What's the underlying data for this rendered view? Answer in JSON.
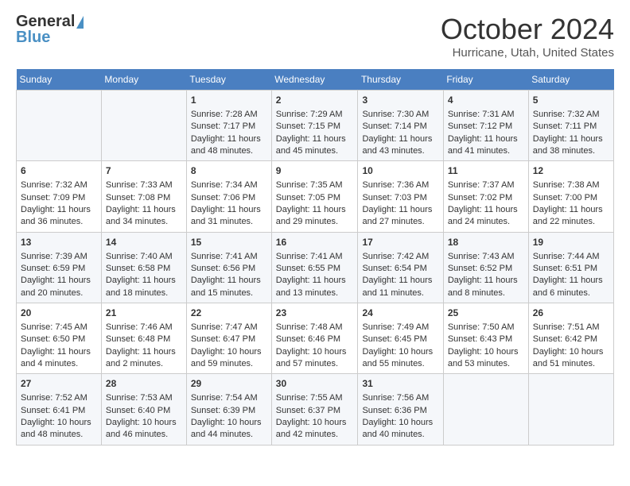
{
  "logo": {
    "general": "General",
    "blue": "Blue"
  },
  "title": "October 2024",
  "location": "Hurricane, Utah, United States",
  "days_of_week": [
    "Sunday",
    "Monday",
    "Tuesday",
    "Wednesday",
    "Thursday",
    "Friday",
    "Saturday"
  ],
  "weeks": [
    [
      {
        "day": "",
        "sunrise": "",
        "sunset": "",
        "daylight": ""
      },
      {
        "day": "",
        "sunrise": "",
        "sunset": "",
        "daylight": ""
      },
      {
        "day": "1",
        "sunrise": "Sunrise: 7:28 AM",
        "sunset": "Sunset: 7:17 PM",
        "daylight": "Daylight: 11 hours and 48 minutes."
      },
      {
        "day": "2",
        "sunrise": "Sunrise: 7:29 AM",
        "sunset": "Sunset: 7:15 PM",
        "daylight": "Daylight: 11 hours and 45 minutes."
      },
      {
        "day": "3",
        "sunrise": "Sunrise: 7:30 AM",
        "sunset": "Sunset: 7:14 PM",
        "daylight": "Daylight: 11 hours and 43 minutes."
      },
      {
        "day": "4",
        "sunrise": "Sunrise: 7:31 AM",
        "sunset": "Sunset: 7:12 PM",
        "daylight": "Daylight: 11 hours and 41 minutes."
      },
      {
        "day": "5",
        "sunrise": "Sunrise: 7:32 AM",
        "sunset": "Sunset: 7:11 PM",
        "daylight": "Daylight: 11 hours and 38 minutes."
      }
    ],
    [
      {
        "day": "6",
        "sunrise": "Sunrise: 7:32 AM",
        "sunset": "Sunset: 7:09 PM",
        "daylight": "Daylight: 11 hours and 36 minutes."
      },
      {
        "day": "7",
        "sunrise": "Sunrise: 7:33 AM",
        "sunset": "Sunset: 7:08 PM",
        "daylight": "Daylight: 11 hours and 34 minutes."
      },
      {
        "day": "8",
        "sunrise": "Sunrise: 7:34 AM",
        "sunset": "Sunset: 7:06 PM",
        "daylight": "Daylight: 11 hours and 31 minutes."
      },
      {
        "day": "9",
        "sunrise": "Sunrise: 7:35 AM",
        "sunset": "Sunset: 7:05 PM",
        "daylight": "Daylight: 11 hours and 29 minutes."
      },
      {
        "day": "10",
        "sunrise": "Sunrise: 7:36 AM",
        "sunset": "Sunset: 7:03 PM",
        "daylight": "Daylight: 11 hours and 27 minutes."
      },
      {
        "day": "11",
        "sunrise": "Sunrise: 7:37 AM",
        "sunset": "Sunset: 7:02 PM",
        "daylight": "Daylight: 11 hours and 24 minutes."
      },
      {
        "day": "12",
        "sunrise": "Sunrise: 7:38 AM",
        "sunset": "Sunset: 7:00 PM",
        "daylight": "Daylight: 11 hours and 22 minutes."
      }
    ],
    [
      {
        "day": "13",
        "sunrise": "Sunrise: 7:39 AM",
        "sunset": "Sunset: 6:59 PM",
        "daylight": "Daylight: 11 hours and 20 minutes."
      },
      {
        "day": "14",
        "sunrise": "Sunrise: 7:40 AM",
        "sunset": "Sunset: 6:58 PM",
        "daylight": "Daylight: 11 hours and 18 minutes."
      },
      {
        "day": "15",
        "sunrise": "Sunrise: 7:41 AM",
        "sunset": "Sunset: 6:56 PM",
        "daylight": "Daylight: 11 hours and 15 minutes."
      },
      {
        "day": "16",
        "sunrise": "Sunrise: 7:41 AM",
        "sunset": "Sunset: 6:55 PM",
        "daylight": "Daylight: 11 hours and 13 minutes."
      },
      {
        "day": "17",
        "sunrise": "Sunrise: 7:42 AM",
        "sunset": "Sunset: 6:54 PM",
        "daylight": "Daylight: 11 hours and 11 minutes."
      },
      {
        "day": "18",
        "sunrise": "Sunrise: 7:43 AM",
        "sunset": "Sunset: 6:52 PM",
        "daylight": "Daylight: 11 hours and 8 minutes."
      },
      {
        "day": "19",
        "sunrise": "Sunrise: 7:44 AM",
        "sunset": "Sunset: 6:51 PM",
        "daylight": "Daylight: 11 hours and 6 minutes."
      }
    ],
    [
      {
        "day": "20",
        "sunrise": "Sunrise: 7:45 AM",
        "sunset": "Sunset: 6:50 PM",
        "daylight": "Daylight: 11 hours and 4 minutes."
      },
      {
        "day": "21",
        "sunrise": "Sunrise: 7:46 AM",
        "sunset": "Sunset: 6:48 PM",
        "daylight": "Daylight: 11 hours and 2 minutes."
      },
      {
        "day": "22",
        "sunrise": "Sunrise: 7:47 AM",
        "sunset": "Sunset: 6:47 PM",
        "daylight": "Daylight: 10 hours and 59 minutes."
      },
      {
        "day": "23",
        "sunrise": "Sunrise: 7:48 AM",
        "sunset": "Sunset: 6:46 PM",
        "daylight": "Daylight: 10 hours and 57 minutes."
      },
      {
        "day": "24",
        "sunrise": "Sunrise: 7:49 AM",
        "sunset": "Sunset: 6:45 PM",
        "daylight": "Daylight: 10 hours and 55 minutes."
      },
      {
        "day": "25",
        "sunrise": "Sunrise: 7:50 AM",
        "sunset": "Sunset: 6:43 PM",
        "daylight": "Daylight: 10 hours and 53 minutes."
      },
      {
        "day": "26",
        "sunrise": "Sunrise: 7:51 AM",
        "sunset": "Sunset: 6:42 PM",
        "daylight": "Daylight: 10 hours and 51 minutes."
      }
    ],
    [
      {
        "day": "27",
        "sunrise": "Sunrise: 7:52 AM",
        "sunset": "Sunset: 6:41 PM",
        "daylight": "Daylight: 10 hours and 48 minutes."
      },
      {
        "day": "28",
        "sunrise": "Sunrise: 7:53 AM",
        "sunset": "Sunset: 6:40 PM",
        "daylight": "Daylight: 10 hours and 46 minutes."
      },
      {
        "day": "29",
        "sunrise": "Sunrise: 7:54 AM",
        "sunset": "Sunset: 6:39 PM",
        "daylight": "Daylight: 10 hours and 44 minutes."
      },
      {
        "day": "30",
        "sunrise": "Sunrise: 7:55 AM",
        "sunset": "Sunset: 6:37 PM",
        "daylight": "Daylight: 10 hours and 42 minutes."
      },
      {
        "day": "31",
        "sunrise": "Sunrise: 7:56 AM",
        "sunset": "Sunset: 6:36 PM",
        "daylight": "Daylight: 10 hours and 40 minutes."
      },
      {
        "day": "",
        "sunrise": "",
        "sunset": "",
        "daylight": ""
      },
      {
        "day": "",
        "sunrise": "",
        "sunset": "",
        "daylight": ""
      }
    ]
  ]
}
